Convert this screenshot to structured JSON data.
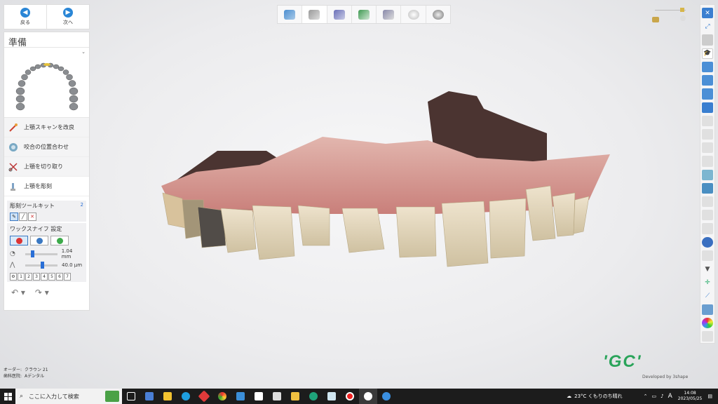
{
  "nav": {
    "back_label": "戻る",
    "next_label": "次へ"
  },
  "panel": {
    "title": "準備",
    "steps": [
      {
        "label": "上顎スキャンを改良"
      },
      {
        "label": "咬合の位置合わせ"
      },
      {
        "label": "上顎を切り取り"
      },
      {
        "label": "上顎を彫刻"
      }
    ],
    "toolkit_title": "彫刻ツールキット",
    "toolkit_number": "2",
    "wax_title": "ワックスナイフ 設定",
    "size_value": "1.04 mm",
    "amount_value": "40.0 µm",
    "numbers": [
      "1",
      "2",
      "3",
      "4",
      "5",
      "6",
      "7"
    ]
  },
  "info": {
    "order_label": "オーダー:",
    "order_value": "クラウン 21",
    "dentist_label": "歯科医院:",
    "dentist_value": "Aデンタル"
  },
  "logo": {
    "text": "'GC'",
    "sub": "Developed by 3shape"
  },
  "taskbar": {
    "search_placeholder": "ここに入力して検索",
    "weather": "23°C くもりのち晴れ",
    "ime": "A",
    "time": "14:08",
    "date": "2023/05/25"
  },
  "colors": {
    "accent": "#2a86d6",
    "logo_green": "#2aa45a",
    "taskbar": "#1c1c1c"
  }
}
